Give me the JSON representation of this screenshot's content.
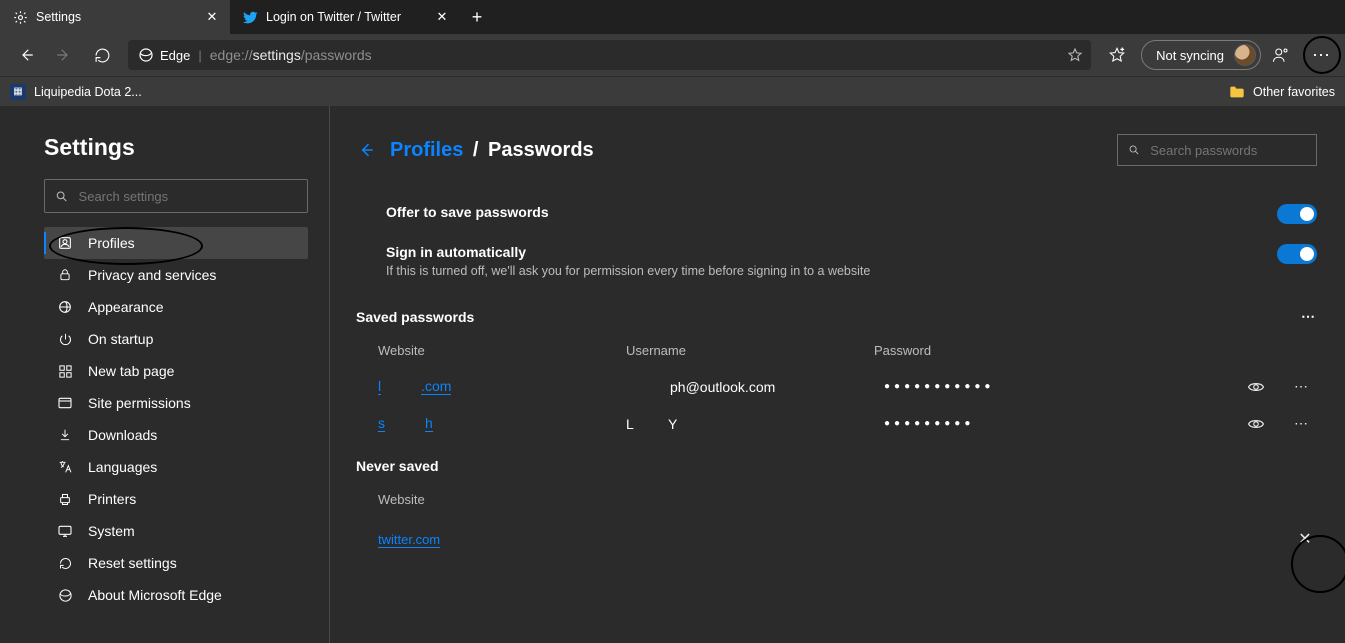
{
  "tabs": [
    {
      "title": "Settings"
    },
    {
      "title": "Login on Twitter / Twitter"
    }
  ],
  "toolbar": {
    "edgeLabel": "Edge",
    "urlGrey1": "edge://",
    "urlWhite": "settings",
    "urlGrey2": "/passwords",
    "syncLabel": "Not syncing"
  },
  "bookmarks": {
    "left": "Liquipedia Dota 2...",
    "right": "Other favorites"
  },
  "sidebar": {
    "title": "Settings",
    "searchPlaceholder": "Search settings",
    "items": [
      "Profiles",
      "Privacy and services",
      "Appearance",
      "On startup",
      "New tab page",
      "Site permissions",
      "Downloads",
      "Languages",
      "Printers",
      "System",
      "Reset settings",
      "About Microsoft Edge"
    ]
  },
  "main": {
    "back": "←",
    "breadcrumbProfiles": "Profiles",
    "breadcrumbSep": "/",
    "breadcrumbCurrent": "Passwords",
    "searchPlaceholder": "Search passwords",
    "offerLabel": "Offer to save passwords",
    "signinLabel": "Sign in automatically",
    "signinSub": "If this is turned off, we'll ask you for permission every time before signing in to a website",
    "savedHead": "Saved passwords",
    "colSite": "Website",
    "colUser": "Username",
    "colPass": "Password",
    "rows": [
      {
        "siteA": "l",
        "siteB": ".com",
        "user": "ph@outlook.com",
        "pass": "●●●●●●●●●●●"
      },
      {
        "siteA": "s",
        "siteB": "h",
        "user": "L         Y",
        "pass": "●●●●●●●●●"
      }
    ],
    "neverHead": "Never saved",
    "neverCol": "Website",
    "neverSite": "twitter.com"
  }
}
